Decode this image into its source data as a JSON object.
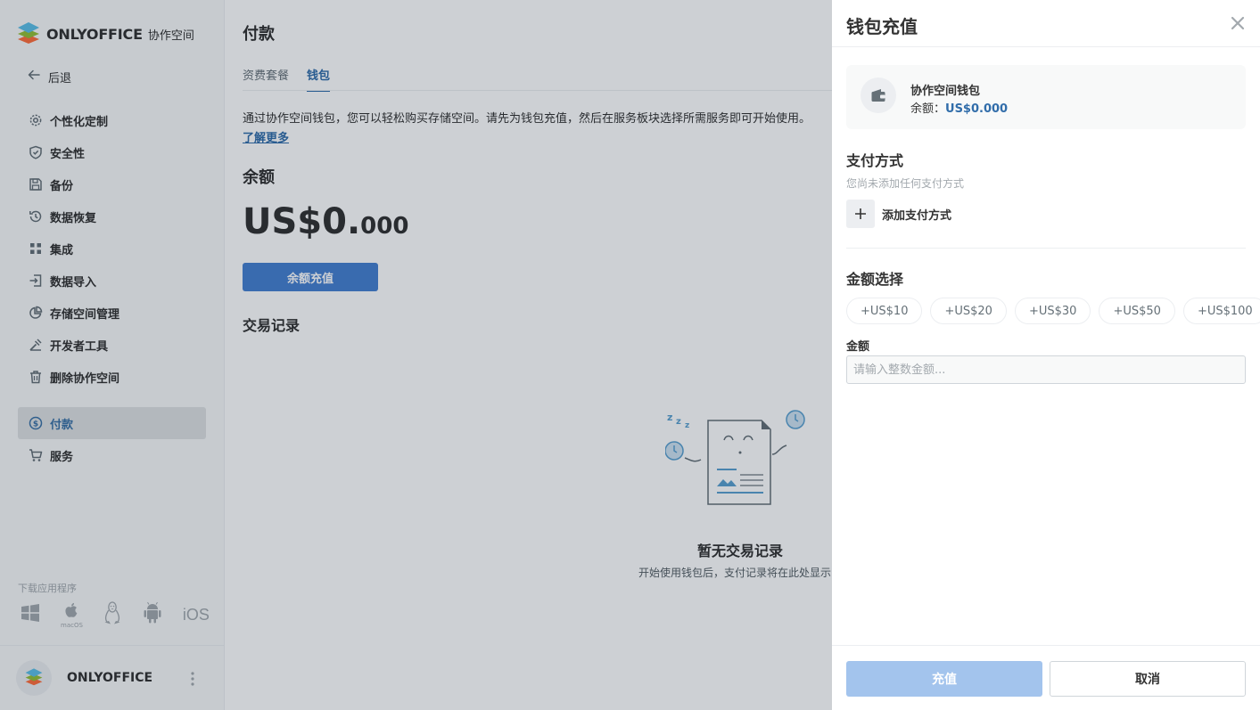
{
  "app": {
    "logo_text": "ONLYOFFICE",
    "logo_sub": "协作空间"
  },
  "sidebar": {
    "back_label": "后退",
    "items": [
      {
        "label": "个性化定制",
        "icon": "gear-icon"
      },
      {
        "label": "安全性",
        "icon": "shield-icon"
      },
      {
        "label": "备份",
        "icon": "save-icon"
      },
      {
        "label": "数据恢复",
        "icon": "history-icon"
      },
      {
        "label": "集成",
        "icon": "grid-icon"
      },
      {
        "label": "数据导入",
        "icon": "import-icon"
      },
      {
        "label": "存储空间管理",
        "icon": "pie-chart-icon"
      },
      {
        "label": "开发者工具",
        "icon": "tools-icon"
      },
      {
        "label": "删除协作空间",
        "icon": "trash-icon"
      },
      {
        "label": "付款",
        "icon": "dollar-icon",
        "active": true
      },
      {
        "label": "服务",
        "icon": "cart-icon"
      }
    ],
    "download_label": "下载应用程序",
    "download_apps": [
      "windows",
      "macOS",
      "linux",
      "android",
      "iOS"
    ],
    "macos_label": "macOS",
    "ios_label": "iOS",
    "footer_name": "ONLYOFFICE"
  },
  "main": {
    "title": "付款",
    "tabs": [
      {
        "label": "资费套餐",
        "active": false
      },
      {
        "label": "钱包",
        "active": true
      }
    ],
    "description": "通过协作空间钱包，您可以轻松购买存储空间。请先为钱包充值，然后在服务板块选择所需服务即可开始使用。",
    "learn_more": "了解更多",
    "balance_heading": "余额",
    "balance_main": "US$0.",
    "balance_decimals": "000",
    "topup_button": "余额充值",
    "transactions_heading": "交易记录",
    "empty_title": "暂无交易记录",
    "empty_desc": "开始使用钱包后，支付记录将在此处显示"
  },
  "panel": {
    "title": "钱包充值",
    "wallet_name": "协作空间钱包",
    "wallet_balance_label": "余额：",
    "wallet_balance_value": "US$0.000",
    "payment_heading": "支付方式",
    "payment_empty": "您尚未添加任何支付方式",
    "add_payment": "添加支付方式",
    "amount_heading": "金额选择",
    "amount_options": [
      "+US$10",
      "+US$20",
      "+US$30",
      "+US$50",
      "+US$100"
    ],
    "amount_label": "金额",
    "amount_placeholder": "请输入整数金额...",
    "amount_value": "",
    "submit_button": "充值",
    "cancel_button": "取消"
  },
  "colors": {
    "accent": "#316daa",
    "primary_button": "#4781d1",
    "disabled_button": "#a3c4ed",
    "active_nav_bg": "#dfe2e3"
  }
}
